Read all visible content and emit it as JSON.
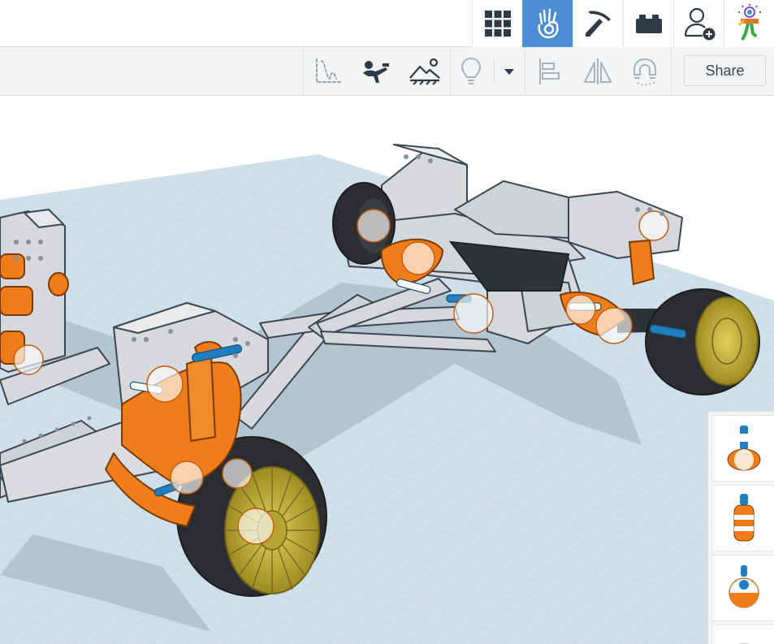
{
  "top_bar": {
    "modes": [
      {
        "icon": "grid-view-icon",
        "active": false
      },
      {
        "icon": "hand-pointer-icon",
        "active": true
      },
      {
        "icon": "pickaxe-icon",
        "active": false
      },
      {
        "icon": "brick-icon",
        "active": false
      },
      {
        "icon": "add-user-icon",
        "active": false
      },
      {
        "icon": "user-avatar-icon",
        "active": false
      }
    ]
  },
  "toolbar": {
    "tools": [
      "physics-drop-icon",
      "character-icon",
      "scene-landscape-icon",
      "light-bulb-icon",
      "dropdown-caret-icon",
      "align-icon",
      "mirror-icon",
      "magnet-icon"
    ],
    "share_label": "Share"
  },
  "colors": {
    "accent": "#4e8ed6",
    "frame_gray": "#d6d8dc",
    "orange": "#ef7d1a",
    "tire": "#2b2d31",
    "rim": "#c9b43a",
    "workplane": "#cfe0ea"
  },
  "parts_panel": {
    "items": [
      {
        "icon": "joint-part-icon-1"
      },
      {
        "icon": "joint-part-icon-2"
      },
      {
        "icon": "joint-part-icon-3"
      },
      {
        "icon": "joint-part-icon-4"
      }
    ]
  }
}
